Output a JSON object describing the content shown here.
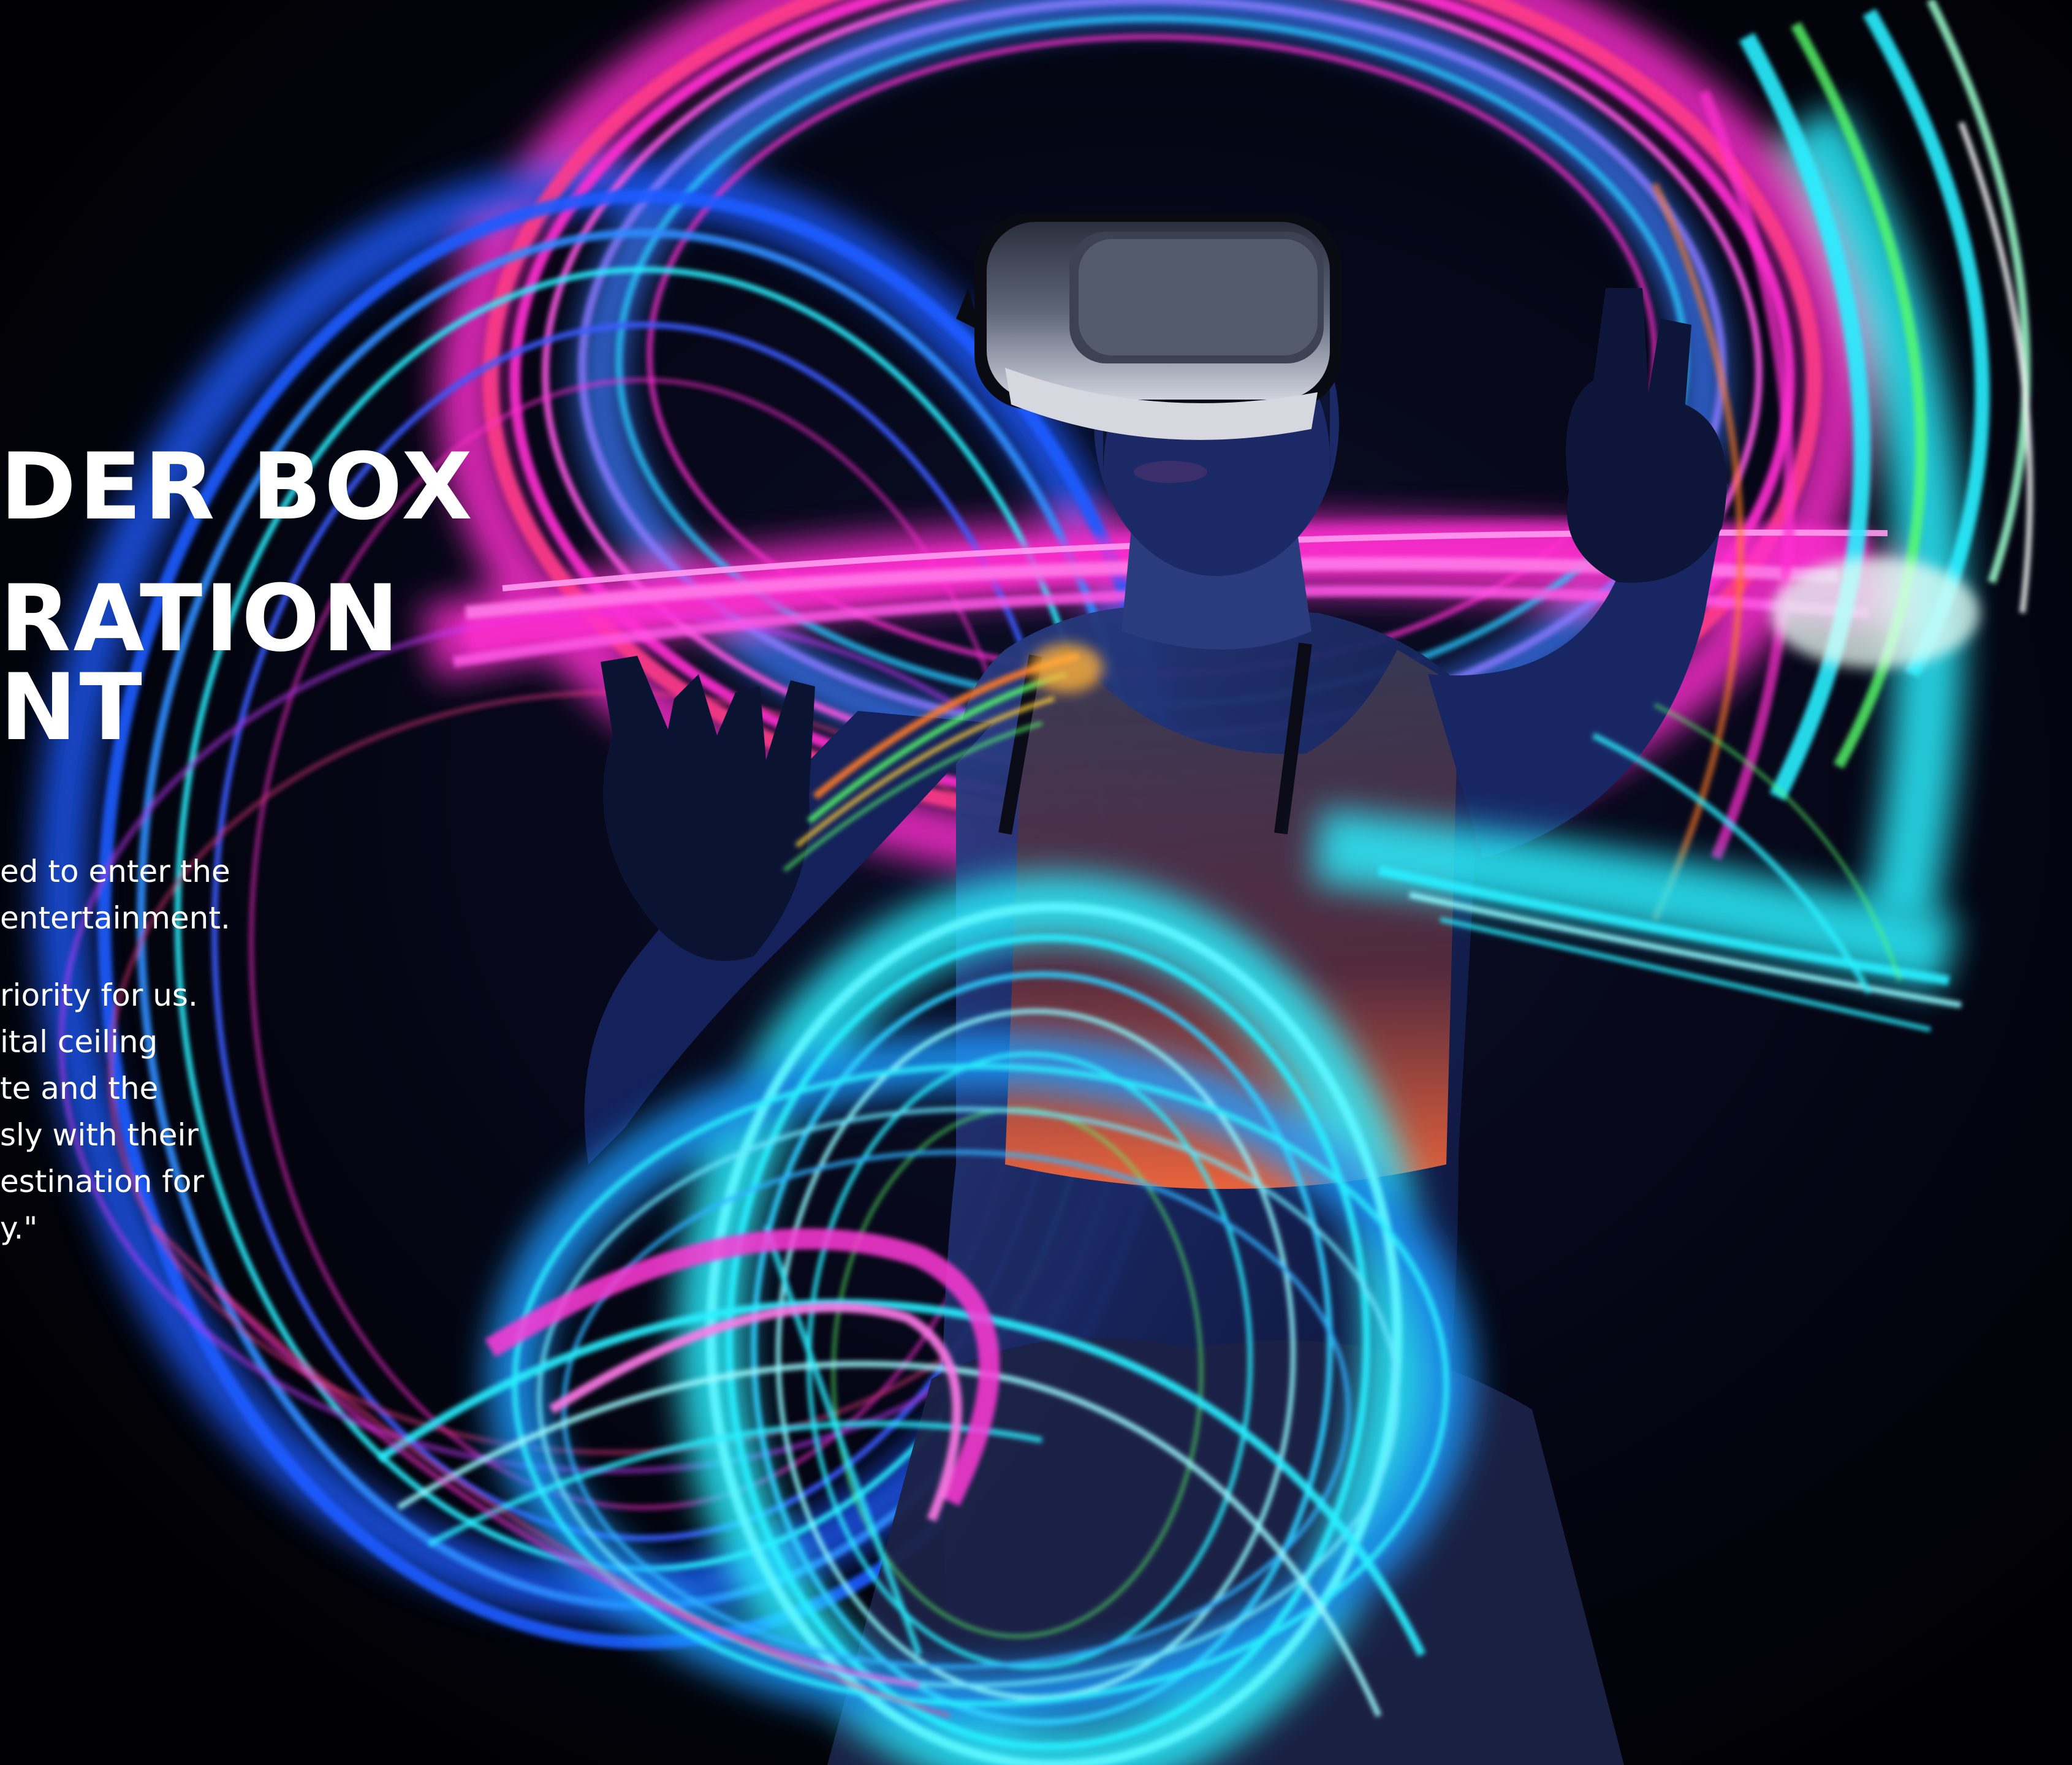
{
  "headline": {
    "line_1": "DER BOX",
    "line_2": "RATION",
    "line_3": "NT"
  },
  "body": {
    "paragraph_1": [
      "ed to enter the",
      "entertainment."
    ],
    "paragraph_2": [
      "riority for us.",
      "ital ceiling",
      "te and the",
      "sly with their",
      "estination for",
      "y.\""
    ]
  },
  "photo": {
    "subject": "person-wearing-vr-headset-icon",
    "palette": {
      "background": "#02020a",
      "magenta": "#ff2fd0",
      "pink": "#ff3b8a",
      "cyan": "#29f0ff",
      "blue": "#1e5bff",
      "green": "#58ff6a",
      "orange": "#ff7a2a",
      "skin_shadow": "#1a2c66",
      "headset": "#d7d7df"
    }
  }
}
